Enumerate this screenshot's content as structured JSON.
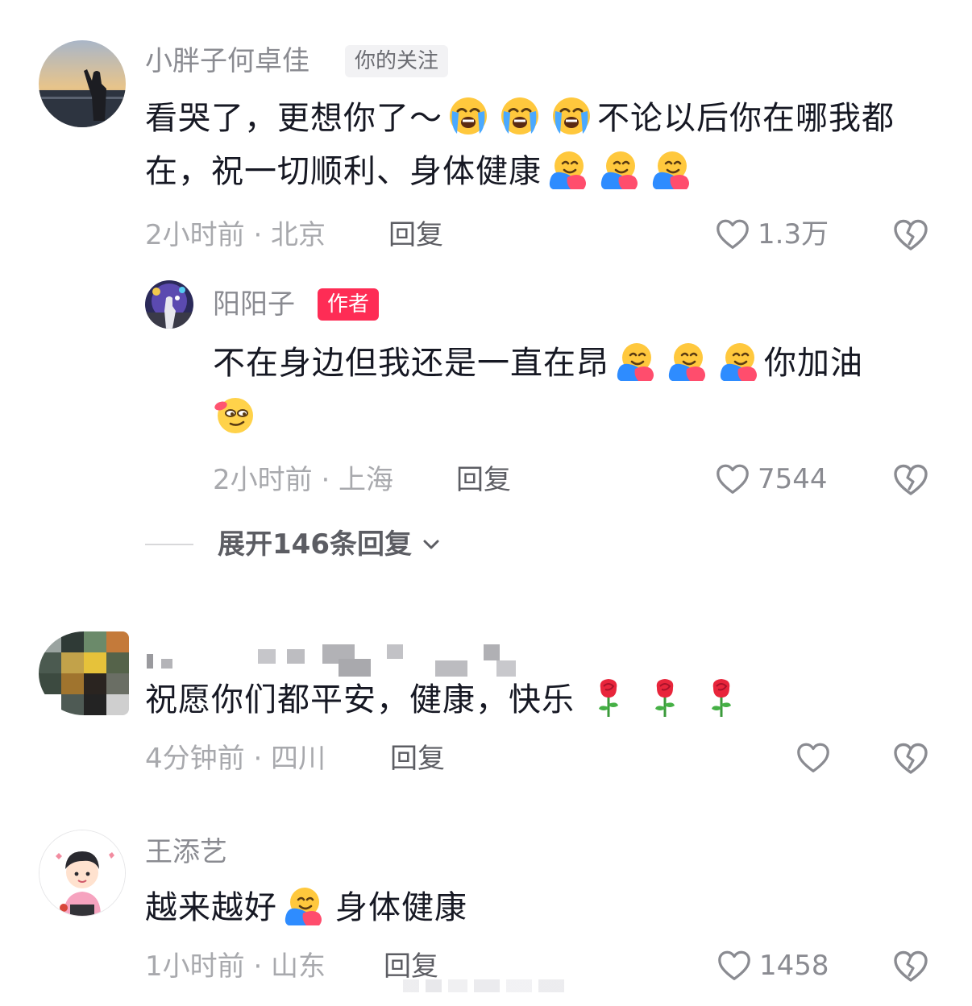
{
  "comments": [
    {
      "username": "小胖子何卓佳",
      "tag": "你的关注",
      "text_a": "看哭了，更想你了～",
      "text_b": "不论以后你在哪我都在，祝一切顺利、身体健康",
      "meta": "2小时前 · 北京",
      "reply_label": "回复",
      "likes": "1.3万",
      "reply": {
        "username": "阳阳子",
        "tag": "作者",
        "text_a": "不在身边但我还是一直在昂",
        "text_b": "你加油",
        "meta": "2小时前 · 上海",
        "reply_label": "回复",
        "likes": "7544"
      },
      "expand_label": "展开146条回复"
    },
    {
      "username": "",
      "text": "祝愿你们都平安，健康，快乐",
      "meta": "4分钟前 · 四川",
      "reply_label": "回复",
      "likes": ""
    },
    {
      "username": "王添艺",
      "text_a": "越来越好",
      "text_b": "身体健康",
      "meta": "1小时前 · 山东",
      "reply_label": "回复",
      "likes": "1458"
    }
  ],
  "icons": {
    "like": "heart-outline-icon",
    "dislike": "broken-heart-icon",
    "expand": "chevron-down-icon",
    "emoji_cry": "loudly-crying-face-emoji",
    "emoji_hug": "hugging-face-emoji",
    "emoji_smirk": "smirking-face-emoji",
    "emoji_rose": "rose-emoji"
  },
  "colors": {
    "author_tag": "#fe2c55",
    "text": "#161823",
    "secondary": "#8a8b91"
  }
}
